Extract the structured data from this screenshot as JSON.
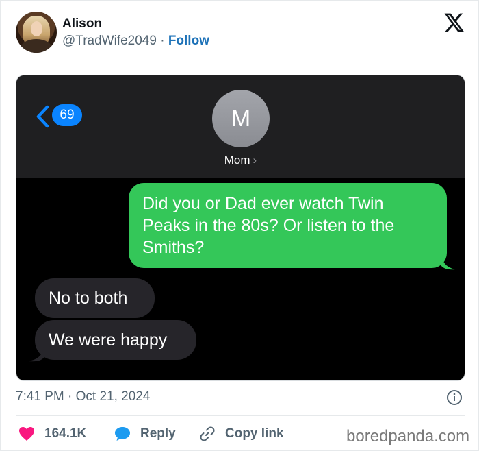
{
  "author": {
    "name": "Alison",
    "handle": "@TradWife2049",
    "separator": " · ",
    "follow_label": "Follow"
  },
  "image": {
    "unread_count": "69",
    "contact_initial": "M",
    "contact_name": "Mom",
    "contact_chevron": "›",
    "messages": [
      {
        "direction": "sent",
        "text": "Did you or Dad ever watch Twin Peaks in the 80s? Or listen to the Smiths?"
      },
      {
        "direction": "received",
        "text": "No to both"
      },
      {
        "direction": "received",
        "text": "We were happy"
      }
    ]
  },
  "meta": {
    "timestamp": "7:41 PM · Oct 21, 2024"
  },
  "actions": {
    "like_count": "164.1K",
    "reply_label": "Reply",
    "copy_label": "Copy link"
  },
  "watermark": "boredpanda.com",
  "colors": {
    "follow": "#1d72b8",
    "like": "#f91880",
    "reply": "#1d9bf0",
    "sent_bubble": "#34c759",
    "received_bubble": "#26252a",
    "ios_blue": "#0a84ff"
  },
  "icons": {
    "platform": "x-logo-icon",
    "back": "chevron-left-icon",
    "info": "info-icon",
    "like": "heart-icon",
    "reply": "speech-bubble-icon",
    "copy": "link-icon"
  }
}
